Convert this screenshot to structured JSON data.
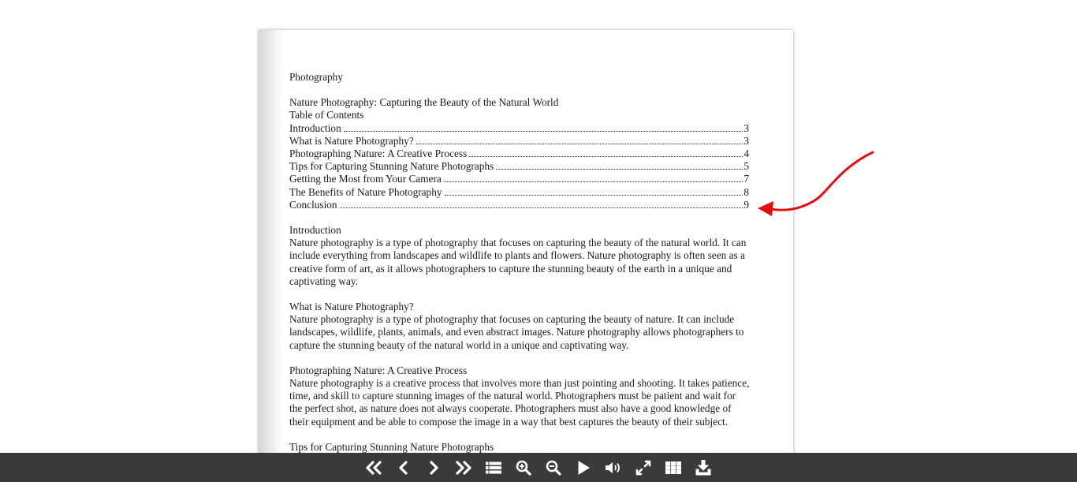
{
  "document": {
    "header": "Photography",
    "title": "Nature Photography: Capturing the Beauty of the Natural World",
    "toc_heading": "Table of Contents",
    "toc": [
      {
        "label": "Introduction",
        "page": "3"
      },
      {
        "label": "What is Nature Photography?",
        "page": "3"
      },
      {
        "label": "Photographing Nature: A Creative Process",
        "page": "4"
      },
      {
        "label": "Tips for Capturing Stunning Nature Photographs",
        "page": "5"
      },
      {
        "label": "Getting the Most from Your Camera",
        "page": "7"
      },
      {
        "label": "The Benefits of Nature Photography",
        "page": "8"
      },
      {
        "label": "Conclusion",
        "page": "9"
      }
    ],
    "sections": [
      {
        "heading": "Introduction",
        "lines": [
          "Nature photography is a type of photography that focuses on capturing the beauty of the natural world. It can",
          "include everything from landscapes and wildlife to plants and flowers. Nature photography is often seen as a",
          "creative form of art, as it allows photographers to capture the stunning beauty of the earth in a unique and",
          "captivating way."
        ]
      },
      {
        "heading": "What is Nature Photography?",
        "lines": [
          "Nature photography is a type of photography that focuses on capturing the beauty of nature. It can include",
          "landscapes, wildlife, plants, animals, and even abstract images. Nature photography allows photographers to",
          "capture the stunning beauty of the natural world in a unique and captivating way."
        ]
      },
      {
        "heading": "Photographing Nature: A Creative Process",
        "lines": [
          "Nature photography is a creative process that involves more than just pointing and shooting. It takes patience,",
          "time, and skill to capture stunning images of the natural world. Photographers must be patient and wait for",
          "the perfect shot, as nature does not always cooperate. Photographers must also have a good knowledge of",
          "their equipment and be able to compose the image in a way that best captures the beauty of their subject."
        ]
      },
      {
        "heading": "Tips for Capturing Stunning Nature Photographs",
        "lines": []
      }
    ]
  },
  "annotation": {
    "color": "#e01010",
    "icon": "red-arrow-pointing-left"
  },
  "toolbar": {
    "background": "#3a3a3a",
    "buttons": [
      {
        "name": "first-page-icon"
      },
      {
        "name": "previous-page-icon"
      },
      {
        "name": "next-page-icon"
      },
      {
        "name": "last-page-icon"
      },
      {
        "name": "table-of-contents-icon"
      },
      {
        "name": "zoom-in-icon"
      },
      {
        "name": "zoom-out-icon"
      },
      {
        "name": "autoplay-icon"
      },
      {
        "name": "sound-icon"
      },
      {
        "name": "fullscreen-icon"
      },
      {
        "name": "thumbnails-icon"
      },
      {
        "name": "download-icon"
      }
    ]
  }
}
